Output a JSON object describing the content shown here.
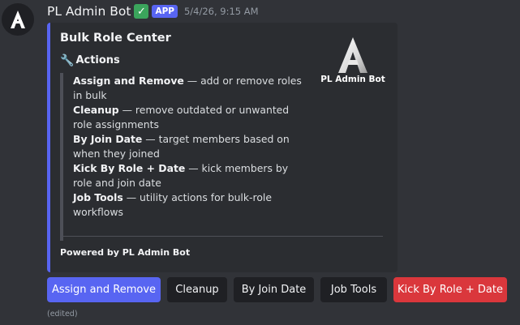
{
  "message": {
    "username": "PL Admin Bot",
    "verified_icon": "verified-check-icon",
    "app_badge": "APP",
    "timestamp": "5/4/26, 9:15 AM",
    "edited": "(edited)"
  },
  "embed": {
    "title": "Bulk Role Center",
    "actions_heading": "Actions",
    "actions_icon": "wrench-icon",
    "items": [
      {
        "name": "Assign and Remove",
        "desc": " — add or remove roles in bulk"
      },
      {
        "name": "Cleanup",
        "desc": " — remove outdated or unwanted role assignments"
      },
      {
        "name": "By Join Date",
        "desc": " — target members based on when they joined"
      },
      {
        "name": "Kick By Role + Date",
        "desc": " — kick members by role and join date"
      },
      {
        "name": "Job Tools",
        "desc": " — utility actions for bulk-role workflows"
      }
    ],
    "thumbnail_name": "PL Admin Bot",
    "footer": "Powered by PL Admin Bot",
    "accent_color": "#5865f2"
  },
  "buttons": [
    {
      "label": "Assign and Remove",
      "style": "primary"
    },
    {
      "label": "Cleanup",
      "style": "secondary"
    },
    {
      "label": "By Join Date",
      "style": "secondary"
    },
    {
      "label": "Job Tools",
      "style": "secondary"
    },
    {
      "label": "Kick By Role + Date",
      "style": "danger"
    }
  ],
  "colors": {
    "background": "#313338",
    "embed_bg": "#2b2d31",
    "primary": "#5865f2",
    "secondary": "#1f2024",
    "danger": "#da373c",
    "verified": "#3ba55c"
  }
}
